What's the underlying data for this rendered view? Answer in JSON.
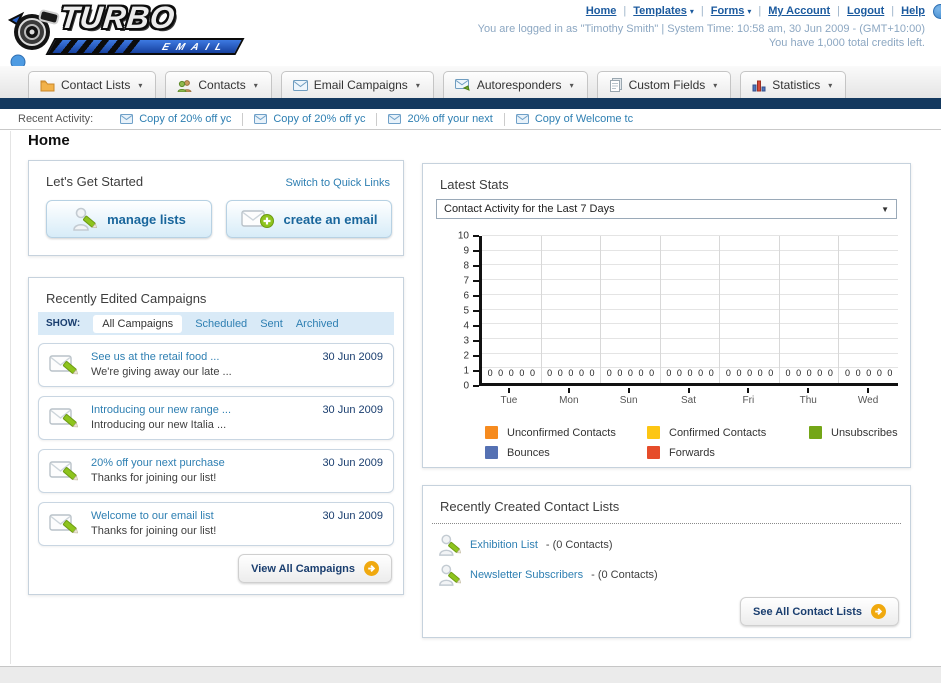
{
  "header": {
    "logo": {
      "top": "TURBO",
      "bottom": "EMAIL"
    },
    "nav_links": [
      {
        "label": "Home",
        "caret": false
      },
      {
        "label": "Templates",
        "caret": true
      },
      {
        "label": "Forms",
        "caret": true
      },
      {
        "label": "My Account",
        "caret": false
      },
      {
        "label": "Logout",
        "caret": false
      },
      {
        "label": "Help",
        "caret": false
      }
    ],
    "login_line1": "You are logged in as \"Timothy Smith\" | System Time: 10:58 am, 30 Jun 2009 - (GMT+10:00)",
    "login_line2": "You have 1,000 total credits left."
  },
  "tabs": [
    {
      "label": "Contact Lists"
    },
    {
      "label": "Contacts"
    },
    {
      "label": "Email Campaigns"
    },
    {
      "label": "Autoresponders"
    },
    {
      "label": "Custom Fields"
    },
    {
      "label": "Statistics"
    }
  ],
  "recent_activity": {
    "label": "Recent Activity:",
    "items": [
      "Copy of 20% off yc",
      "Copy of 20% off yc",
      "20% off your next",
      "Copy of Welcome tc"
    ]
  },
  "page_title": "Home",
  "get_started": {
    "title": "Let's Get Started",
    "switch_link": "Switch to Quick Links",
    "manage_button": "manage lists",
    "create_button": "create an email"
  },
  "campaigns": {
    "title": "Recently Edited Campaigns",
    "show_label": "SHOW:",
    "filters": [
      "All Campaigns",
      "Scheduled",
      "Sent",
      "Archived"
    ],
    "active_filter": "All Campaigns",
    "items": [
      {
        "title": "See us at the retail food ...",
        "subtitle": "We're giving away our late ...",
        "date": "30 Jun 2009"
      },
      {
        "title": "Introducing our new range ...",
        "subtitle": "Introducing our new Italia ...",
        "date": "30 Jun 2009"
      },
      {
        "title": "20% off your next purchase",
        "subtitle": "Thanks for joining our list!",
        "date": "30 Jun 2009"
      },
      {
        "title": "Welcome to our email list",
        "subtitle": "Thanks for joining our list!",
        "date": "30 Jun 2009"
      }
    ],
    "view_all_label": "View All Campaigns"
  },
  "stats": {
    "title": "Latest Stats",
    "dropdown_value": "Contact Activity for the Last 7 Days",
    "chart_data": {
      "type": "bar",
      "categories": [
        "Tue",
        "Mon",
        "Sun",
        "Sat",
        "Fri",
        "Thu",
        "Wed"
      ],
      "series": [
        {
          "name": "Unconfirmed Contacts",
          "color": "#f68b1f",
          "values": [
            0,
            0,
            0,
            0,
            0,
            0,
            0
          ]
        },
        {
          "name": "Confirmed Contacts",
          "color": "#fdc613",
          "values": [
            0,
            0,
            0,
            0,
            0,
            0,
            0
          ]
        },
        {
          "name": "Unsubscribes",
          "color": "#74a617",
          "values": [
            0,
            0,
            0,
            0,
            0,
            0,
            0
          ]
        },
        {
          "name": "Bounces",
          "color": "#5571b3",
          "values": [
            0,
            0,
            0,
            0,
            0,
            0,
            0
          ]
        },
        {
          "name": "Forwards",
          "color": "#e64c2a",
          "values": [
            0,
            0,
            0,
            0,
            0,
            0,
            0
          ]
        }
      ],
      "ylim": [
        0,
        10
      ],
      "ytick_step": 1,
      "grid": true,
      "value_labels": true,
      "legend_position": "bottom"
    }
  },
  "contact_lists": {
    "title": "Recently Created Contact Lists",
    "items": [
      {
        "name": "Exhibition List",
        "detail": "- (0 Contacts)"
      },
      {
        "name": "Newsletter Subscribers",
        "detail": "- (0 Contacts)"
      }
    ],
    "see_all_label": "See All Contact Lists"
  }
}
